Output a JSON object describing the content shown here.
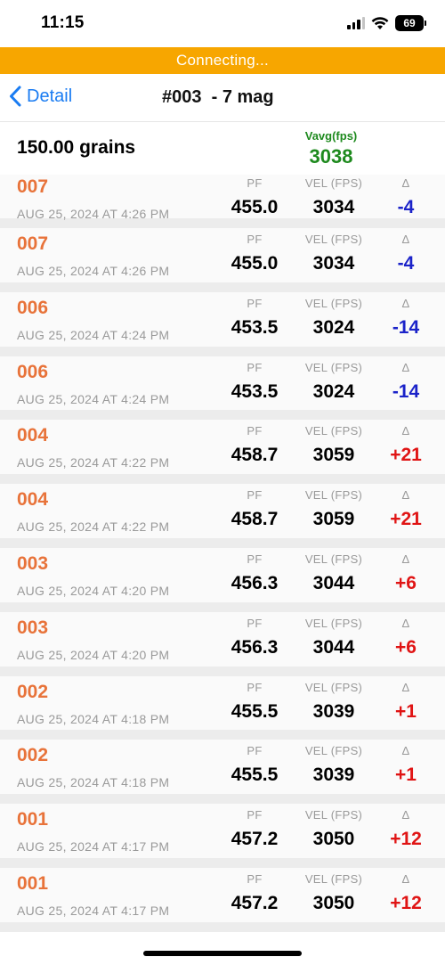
{
  "status": {
    "time": "11:15",
    "battery": "69"
  },
  "banner": {
    "text": "Connecting..."
  },
  "nav": {
    "back_label": "Detail",
    "title": "#003  - 7 mag"
  },
  "summary": {
    "grains": "150.00 grains",
    "vavg_label": "Vavg(fps)",
    "vavg_value": "3038"
  },
  "columns": {
    "pf": "PF",
    "vel": "VEL (FPS)",
    "delta": "Δ"
  },
  "colors": {
    "banner": "#f7a600",
    "accent": "#1a7cf2",
    "shot_number": "#e8733a",
    "vavg": "#1e8a1e",
    "negative": "#1b23c9",
    "positive": "#e01414"
  },
  "shots": [
    {
      "num": "007",
      "time": "AUG 25, 2024 AT 4:26 PM",
      "pf": "455.0",
      "vel": "3034",
      "delta": "-4",
      "sign": "neg"
    },
    {
      "num": "007",
      "time": "AUG 25, 2024 AT 4:26 PM",
      "pf": "455.0",
      "vel": "3034",
      "delta": "-4",
      "sign": "neg"
    },
    {
      "num": "006",
      "time": "AUG 25, 2024 AT 4:24 PM",
      "pf": "453.5",
      "vel": "3024",
      "delta": "-14",
      "sign": "neg"
    },
    {
      "num": "006",
      "time": "AUG 25, 2024 AT 4:24 PM",
      "pf": "453.5",
      "vel": "3024",
      "delta": "-14",
      "sign": "neg"
    },
    {
      "num": "004",
      "time": "AUG 25, 2024 AT 4:22 PM",
      "pf": "458.7",
      "vel": "3059",
      "delta": "+21",
      "sign": "pos"
    },
    {
      "num": "004",
      "time": "AUG 25, 2024 AT 4:22 PM",
      "pf": "458.7",
      "vel": "3059",
      "delta": "+21",
      "sign": "pos"
    },
    {
      "num": "003",
      "time": "AUG 25, 2024 AT 4:20 PM",
      "pf": "456.3",
      "vel": "3044",
      "delta": "+6",
      "sign": "pos"
    },
    {
      "num": "003",
      "time": "AUG 25, 2024 AT 4:20 PM",
      "pf": "456.3",
      "vel": "3044",
      "delta": "+6",
      "sign": "pos"
    },
    {
      "num": "002",
      "time": "AUG 25, 2024 AT 4:18 PM",
      "pf": "455.5",
      "vel": "3039",
      "delta": "+1",
      "sign": "pos"
    },
    {
      "num": "002",
      "time": "AUG 25, 2024 AT 4:18 PM",
      "pf": "455.5",
      "vel": "3039",
      "delta": "+1",
      "sign": "pos"
    },
    {
      "num": "001",
      "time": "AUG 25, 2024 AT 4:17 PM",
      "pf": "457.2",
      "vel": "3050",
      "delta": "+12",
      "sign": "pos"
    },
    {
      "num": "001",
      "time": "AUG 25, 2024 AT 4:17 PM",
      "pf": "457.2",
      "vel": "3050",
      "delta": "+12",
      "sign": "pos"
    }
  ]
}
